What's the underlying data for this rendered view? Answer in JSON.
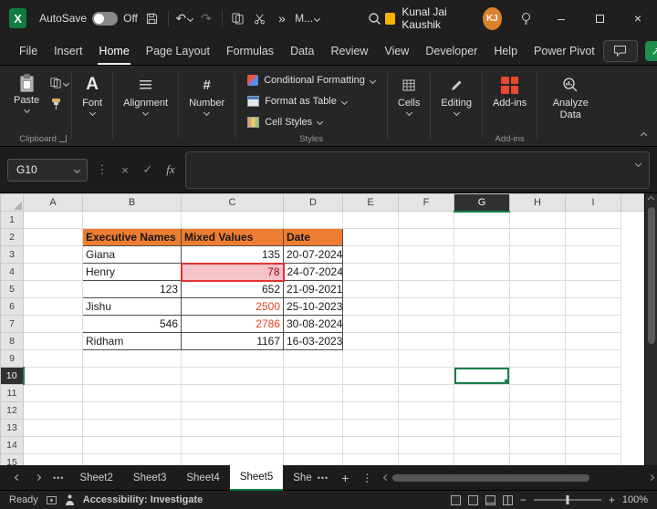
{
  "colors": {
    "excel-green": "#107C41",
    "share-green": "#1E8E4E",
    "table-header-fill": "#ED7D31",
    "highlight-fill": "#F6C3CA",
    "highlight-border": "#DE3333",
    "highlight-text": "#9C0006",
    "red-number": "#E8401E",
    "selection-green": "#1A7F4B",
    "avatar-orange": "#D9822B",
    "addins-orange": "#E8492F"
  },
  "icons": {
    "undo": "↶",
    "redo": "↷",
    "overflow": "»",
    "vertical_dots": "⋮",
    "horizontal_dots": "•••",
    "cancel": "×",
    "enter": "✓",
    "minimize": "–",
    "share_arrow": "↗",
    "font_icon": "A",
    "number_icon": "#"
  },
  "titlebar": {
    "autosave_label": "AutoSave",
    "autosave_state": "Off",
    "quick_menu_label": "M...",
    "user_name": "Kunal Jai Kaushik",
    "user_initials": "KJ"
  },
  "menu": {
    "tabs": [
      "File",
      "Insert",
      "Home",
      "Page Layout",
      "Formulas",
      "Data",
      "Review",
      "View",
      "Developer",
      "Help",
      "Power Pivot"
    ]
  },
  "ribbon": {
    "paste_label": "Paste",
    "font_label": "Font",
    "alignment_label": "Alignment",
    "number_label": "Number",
    "conditional_formatting_label": "Conditional Formatting",
    "format_as_table_label": "Format as Table",
    "cell_styles_label": "Cell Styles",
    "cells_label": "Cells",
    "editing_label": "Editing",
    "addins_label": "Add-ins",
    "analyze_data_label": "Analyze Data",
    "group_clipboard": "Clipboard",
    "group_styles": "Styles",
    "group_addins": "Add-ins"
  },
  "formula_bar": {
    "name_box": "G10",
    "fx_label": "fx",
    "formula_value": ""
  },
  "grid": {
    "columns": [
      "A",
      "B",
      "C",
      "D",
      "E",
      "F",
      "G",
      "H",
      "I"
    ],
    "row_numbers": [
      "1",
      "2",
      "3",
      "4",
      "5",
      "6",
      "7",
      "8",
      "9",
      "10",
      "11",
      "12",
      "13",
      "14",
      "15"
    ],
    "selected_column": "G",
    "selected_row": "10",
    "selection": "G10"
  },
  "sheet": {
    "cells": {
      "B2": {
        "v": "Executive Names",
        "cls": "hdr"
      },
      "C2": {
        "v": "Mixed Values",
        "cls": "hdr"
      },
      "D2": {
        "v": "Date",
        "cls": "hdr"
      },
      "B3": {
        "v": "Giana",
        "cls": "tb"
      },
      "C3": {
        "v": "135",
        "cls": "tb num"
      },
      "D3": {
        "v": "20-07-2024",
        "cls": "tb"
      },
      "B4": {
        "v": "Henry",
        "cls": "tb"
      },
      "C4": {
        "v": "78",
        "cls": "tb num hl"
      },
      "D4": {
        "v": "24-07-2024",
        "cls": "tb"
      },
      "B5": {
        "v": "123",
        "cls": "tb num"
      },
      "C5": {
        "v": "652",
        "cls": "tb num"
      },
      "D5": {
        "v": "21-09-2021",
        "cls": "tb"
      },
      "B6": {
        "v": "Jishu",
        "cls": "tb"
      },
      "C6": {
        "v": "2500",
        "cls": "tb num red"
      },
      "D6": {
        "v": "25-10-2023",
        "cls": "tb"
      },
      "B7": {
        "v": "546",
        "cls": "tb num"
      },
      "C7": {
        "v": "2786",
        "cls": "tb num red"
      },
      "D7": {
        "v": "30-08-2024",
        "cls": "tb"
      },
      "B8": {
        "v": "Ridham",
        "cls": "tb"
      },
      "C8": {
        "v": "1167",
        "cls": "tb num"
      },
      "D8": {
        "v": "16-03-2023",
        "cls": "tb"
      }
    }
  },
  "sheet_tabs": {
    "labels": [
      "Sheet2",
      "Sheet3",
      "Sheet4",
      "Sheet5",
      "She"
    ],
    "active": "Sheet5"
  },
  "status_bar": {
    "ready_label": "Ready",
    "accessibility_label": "Accessibility: Investigate",
    "zoom_level": "100%"
  }
}
